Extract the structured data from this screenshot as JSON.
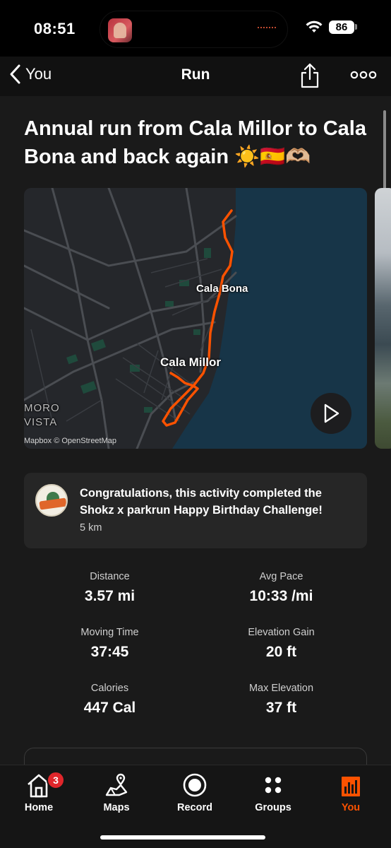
{
  "status_bar": {
    "time": "08:51",
    "battery": "86"
  },
  "nav": {
    "back_label": "You",
    "title": "Run"
  },
  "activity": {
    "title": "Annual run from Cala Millor to Cala Bona and back again ☀️🇪🇸🫶🏼"
  },
  "map": {
    "label_cala_bona": "Cala Bona",
    "label_cala_millor": "Cala Millor",
    "label_moro_line1": "MORO",
    "label_moro_line2": "VISTA",
    "attribution": "Mapbox © OpenStreetMap",
    "route_color": "#fc5200"
  },
  "achievement": {
    "text": "Congratulations, this activity completed the Shokz x parkrun Happy Birthday Challenge!",
    "subtext": "5 km"
  },
  "stats": [
    {
      "label": "Distance",
      "value": "3.57 mi"
    },
    {
      "label": "Avg Pace",
      "value": "10:33 /mi"
    },
    {
      "label": "Moving Time",
      "value": "37:45"
    },
    {
      "label": "Elevation Gain",
      "value": "20 ft"
    },
    {
      "label": "Calories",
      "value": "447 Cal"
    },
    {
      "label": "Max Elevation",
      "value": "37 ft"
    }
  ],
  "tabs": [
    {
      "label": "Home",
      "icon": "home-icon",
      "badge": "3"
    },
    {
      "label": "Maps",
      "icon": "maps-icon"
    },
    {
      "label": "Record",
      "icon": "record-icon"
    },
    {
      "label": "Groups",
      "icon": "groups-icon"
    },
    {
      "label": "You",
      "icon": "you-icon",
      "active": true
    }
  ],
  "colors": {
    "accent": "#fc5200",
    "background": "#1a1a1a",
    "card": "#262626",
    "badge_red": "#e0262b"
  }
}
